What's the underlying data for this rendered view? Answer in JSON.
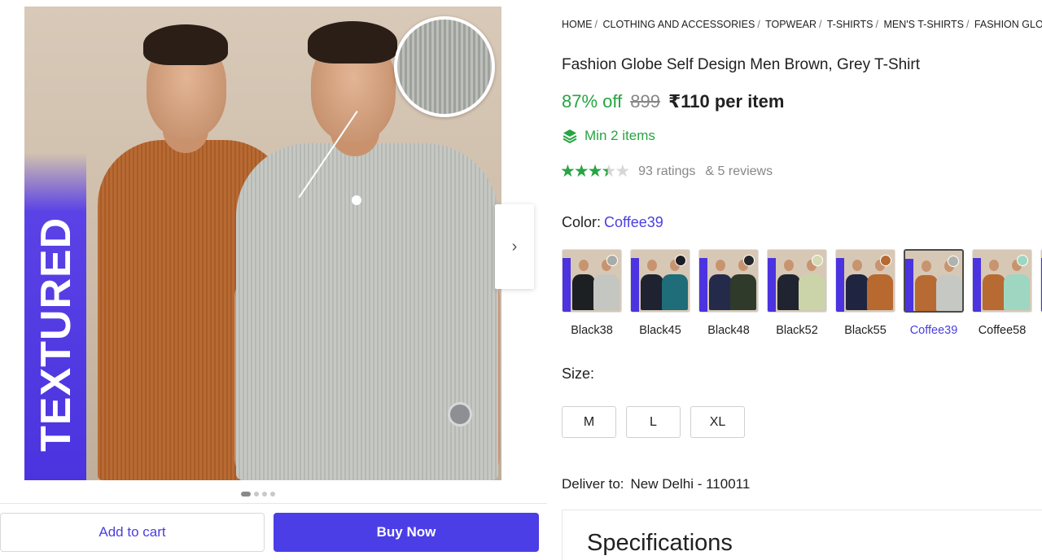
{
  "gallery": {
    "badge_text": "TEXTURED",
    "next_arrow": "›",
    "dots": 4,
    "active_dot": 0
  },
  "actions": {
    "add_to_cart": "Add to cart",
    "buy_now": "Buy Now"
  },
  "breadcrumb": [
    "HOME",
    "CLOTHING AND ACCESSORIES",
    "TOPWEAR",
    "T-SHIRTS",
    "MEN'S T-SHIRTS",
    "FASHION GLOBE MI"
  ],
  "product": {
    "title": "Fashion Globe Self Design Men Brown, Grey T-Shirt",
    "discount": "87% off",
    "mrp": "899",
    "price": "₹110 per item",
    "min_items": "Min 2 items",
    "rating_value": 3.5,
    "ratings": "93 ratings",
    "reviews": "& 5 reviews"
  },
  "color": {
    "label": "Color:",
    "selected": "Coffee39",
    "options": [
      {
        "name": "Black38",
        "left": "#1d2022",
        "right": "#c4c6c2",
        "lens": "#a9aba7"
      },
      {
        "name": "Black45",
        "left": "#1f2230",
        "right": "#1e6d78",
        "lens": "#1b1e22"
      },
      {
        "name": "Black48",
        "left": "#242a4a",
        "right": "#2f3a2a",
        "lens": "#23282a"
      },
      {
        "name": "Black52",
        "left": "#1f2430",
        "right": "#cbd4a8",
        "lens": "#d5d9b4"
      },
      {
        "name": "Black55",
        "left": "#1f2540",
        "right": "#b8692f",
        "lens": "#b8692f"
      },
      {
        "name": "Coffee39",
        "left": "#b86a33",
        "right": "#c6c8c4",
        "lens": "#b0b2ae"
      },
      {
        "name": "Coffee58",
        "left": "#b86a33",
        "right": "#9fd6c2",
        "lens": "#9fd6c2"
      },
      {
        "name": "",
        "left": "#2a2f5a",
        "right": "#8a8ee0",
        "lens": "#8a8ee0"
      }
    ]
  },
  "size": {
    "label": "Size:",
    "options": [
      "M",
      "L",
      "XL"
    ]
  },
  "delivery": {
    "label": "Deliver to:",
    "location": "New Delhi - 110011"
  },
  "specifications": {
    "title": "Specifications"
  },
  "colors": {
    "accent": "#4a3ee0",
    "buy_button": "#4b3ee6",
    "discount_green": "#26a541",
    "muted": "#878787"
  }
}
